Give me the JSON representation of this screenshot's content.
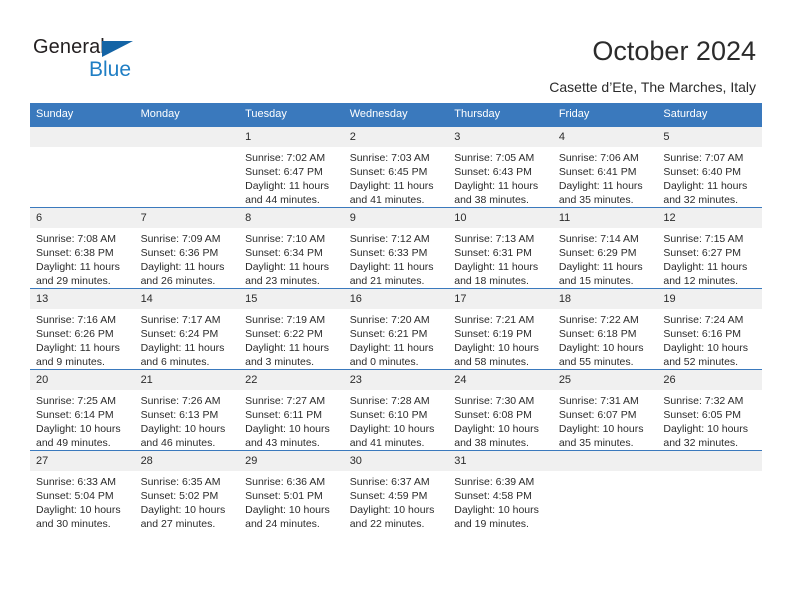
{
  "logo": {
    "word_top": "General",
    "word_bottom": "Blue",
    "triangle_color": "#1464a5",
    "blue_color": "#1f7ec4"
  },
  "header": {
    "title": "October 2024",
    "subtitle": "Casette d’Ete, The Marches, Italy"
  },
  "calendar": {
    "accent_color": "#3a79bd",
    "daynum_bg": "#f0f0f0",
    "weekday_headers": [
      "Sunday",
      "Monday",
      "Tuesday",
      "Wednesday",
      "Thursday",
      "Friday",
      "Saturday"
    ],
    "weeks": [
      [
        {
          "day": "",
          "lines": []
        },
        {
          "day": "",
          "lines": []
        },
        {
          "day": "1",
          "lines": [
            "Sunrise: 7:02 AM",
            "Sunset: 6:47 PM",
            "Daylight: 11 hours",
            "and 44 minutes."
          ]
        },
        {
          "day": "2",
          "lines": [
            "Sunrise: 7:03 AM",
            "Sunset: 6:45 PM",
            "Daylight: 11 hours",
            "and 41 minutes."
          ]
        },
        {
          "day": "3",
          "lines": [
            "Sunrise: 7:05 AM",
            "Sunset: 6:43 PM",
            "Daylight: 11 hours",
            "and 38 minutes."
          ]
        },
        {
          "day": "4",
          "lines": [
            "Sunrise: 7:06 AM",
            "Sunset: 6:41 PM",
            "Daylight: 11 hours",
            "and 35 minutes."
          ]
        },
        {
          "day": "5",
          "lines": [
            "Sunrise: 7:07 AM",
            "Sunset: 6:40 PM",
            "Daylight: 11 hours",
            "and 32 minutes."
          ]
        }
      ],
      [
        {
          "day": "6",
          "lines": [
            "Sunrise: 7:08 AM",
            "Sunset: 6:38 PM",
            "Daylight: 11 hours",
            "and 29 minutes."
          ]
        },
        {
          "day": "7",
          "lines": [
            "Sunrise: 7:09 AM",
            "Sunset: 6:36 PM",
            "Daylight: 11 hours",
            "and 26 minutes."
          ]
        },
        {
          "day": "8",
          "lines": [
            "Sunrise: 7:10 AM",
            "Sunset: 6:34 PM",
            "Daylight: 11 hours",
            "and 23 minutes."
          ]
        },
        {
          "day": "9",
          "lines": [
            "Sunrise: 7:12 AM",
            "Sunset: 6:33 PM",
            "Daylight: 11 hours",
            "and 21 minutes."
          ]
        },
        {
          "day": "10",
          "lines": [
            "Sunrise: 7:13 AM",
            "Sunset: 6:31 PM",
            "Daylight: 11 hours",
            "and 18 minutes."
          ]
        },
        {
          "day": "11",
          "lines": [
            "Sunrise: 7:14 AM",
            "Sunset: 6:29 PM",
            "Daylight: 11 hours",
            "and 15 minutes."
          ]
        },
        {
          "day": "12",
          "lines": [
            "Sunrise: 7:15 AM",
            "Sunset: 6:27 PM",
            "Daylight: 11 hours",
            "and 12 minutes."
          ]
        }
      ],
      [
        {
          "day": "13",
          "lines": [
            "Sunrise: 7:16 AM",
            "Sunset: 6:26 PM",
            "Daylight: 11 hours",
            "and 9 minutes."
          ]
        },
        {
          "day": "14",
          "lines": [
            "Sunrise: 7:17 AM",
            "Sunset: 6:24 PM",
            "Daylight: 11 hours",
            "and 6 minutes."
          ]
        },
        {
          "day": "15",
          "lines": [
            "Sunrise: 7:19 AM",
            "Sunset: 6:22 PM",
            "Daylight: 11 hours",
            "and 3 minutes."
          ]
        },
        {
          "day": "16",
          "lines": [
            "Sunrise: 7:20 AM",
            "Sunset: 6:21 PM",
            "Daylight: 11 hours",
            "and 0 minutes."
          ]
        },
        {
          "day": "17",
          "lines": [
            "Sunrise: 7:21 AM",
            "Sunset: 6:19 PM",
            "Daylight: 10 hours",
            "and 58 minutes."
          ]
        },
        {
          "day": "18",
          "lines": [
            "Sunrise: 7:22 AM",
            "Sunset: 6:18 PM",
            "Daylight: 10 hours",
            "and 55 minutes."
          ]
        },
        {
          "day": "19",
          "lines": [
            "Sunrise: 7:24 AM",
            "Sunset: 6:16 PM",
            "Daylight: 10 hours",
            "and 52 minutes."
          ]
        }
      ],
      [
        {
          "day": "20",
          "lines": [
            "Sunrise: 7:25 AM",
            "Sunset: 6:14 PM",
            "Daylight: 10 hours",
            "and 49 minutes."
          ]
        },
        {
          "day": "21",
          "lines": [
            "Sunrise: 7:26 AM",
            "Sunset: 6:13 PM",
            "Daylight: 10 hours",
            "and 46 minutes."
          ]
        },
        {
          "day": "22",
          "lines": [
            "Sunrise: 7:27 AM",
            "Sunset: 6:11 PM",
            "Daylight: 10 hours",
            "and 43 minutes."
          ]
        },
        {
          "day": "23",
          "lines": [
            "Sunrise: 7:28 AM",
            "Sunset: 6:10 PM",
            "Daylight: 10 hours",
            "and 41 minutes."
          ]
        },
        {
          "day": "24",
          "lines": [
            "Sunrise: 7:30 AM",
            "Sunset: 6:08 PM",
            "Daylight: 10 hours",
            "and 38 minutes."
          ]
        },
        {
          "day": "25",
          "lines": [
            "Sunrise: 7:31 AM",
            "Sunset: 6:07 PM",
            "Daylight: 10 hours",
            "and 35 minutes."
          ]
        },
        {
          "day": "26",
          "lines": [
            "Sunrise: 7:32 AM",
            "Sunset: 6:05 PM",
            "Daylight: 10 hours",
            "and 32 minutes."
          ]
        }
      ],
      [
        {
          "day": "27",
          "lines": [
            "Sunrise: 6:33 AM",
            "Sunset: 5:04 PM",
            "Daylight: 10 hours",
            "and 30 minutes."
          ]
        },
        {
          "day": "28",
          "lines": [
            "Sunrise: 6:35 AM",
            "Sunset: 5:02 PM",
            "Daylight: 10 hours",
            "and 27 minutes."
          ]
        },
        {
          "day": "29",
          "lines": [
            "Sunrise: 6:36 AM",
            "Sunset: 5:01 PM",
            "Daylight: 10 hours",
            "and 24 minutes."
          ]
        },
        {
          "day": "30",
          "lines": [
            "Sunrise: 6:37 AM",
            "Sunset: 4:59 PM",
            "Daylight: 10 hours",
            "and 22 minutes."
          ]
        },
        {
          "day": "31",
          "lines": [
            "Sunrise: 6:39 AM",
            "Sunset: 4:58 PM",
            "Daylight: 10 hours",
            "and 19 minutes."
          ]
        },
        {
          "day": "",
          "lines": []
        },
        {
          "day": "",
          "lines": []
        }
      ]
    ]
  }
}
